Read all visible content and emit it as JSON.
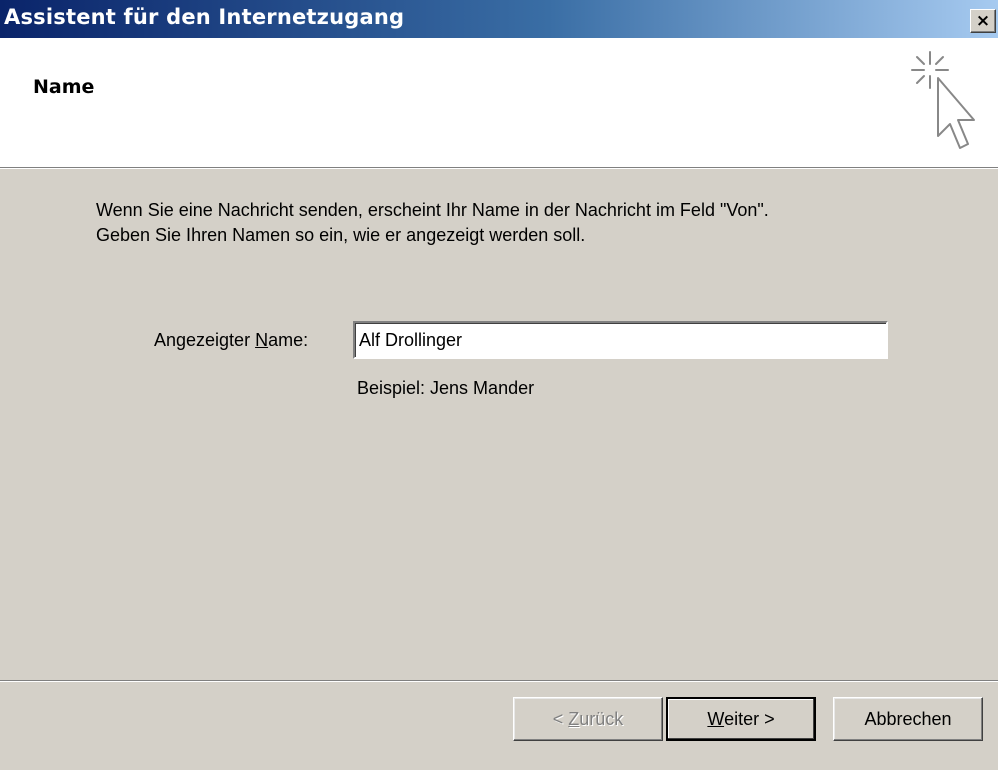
{
  "window": {
    "title": "Assistent für den Internetzugang",
    "close_glyph": "×"
  },
  "header": {
    "title": "Name",
    "icon": "wizard-cursor-icon"
  },
  "content": {
    "intro_line1": "Wenn Sie eine Nachricht senden, erscheint Ihr Name in der Nachricht im Feld \"Von\".",
    "intro_line2": "Geben Sie Ihren Namen so ein, wie er angezeigt werden soll.",
    "field_label_pre": "Angezeigter ",
    "field_label_hotkey": "N",
    "field_label_post": "ame:",
    "field_value": "Alf Drollinger",
    "example": "Beispiel: Jens Mander"
  },
  "buttons": {
    "back_pre": "< ",
    "back_hotkey": "Z",
    "back_post": "urück",
    "next_hotkey": "W",
    "next_post": "eiter >",
    "cancel": "Abbrechen"
  }
}
